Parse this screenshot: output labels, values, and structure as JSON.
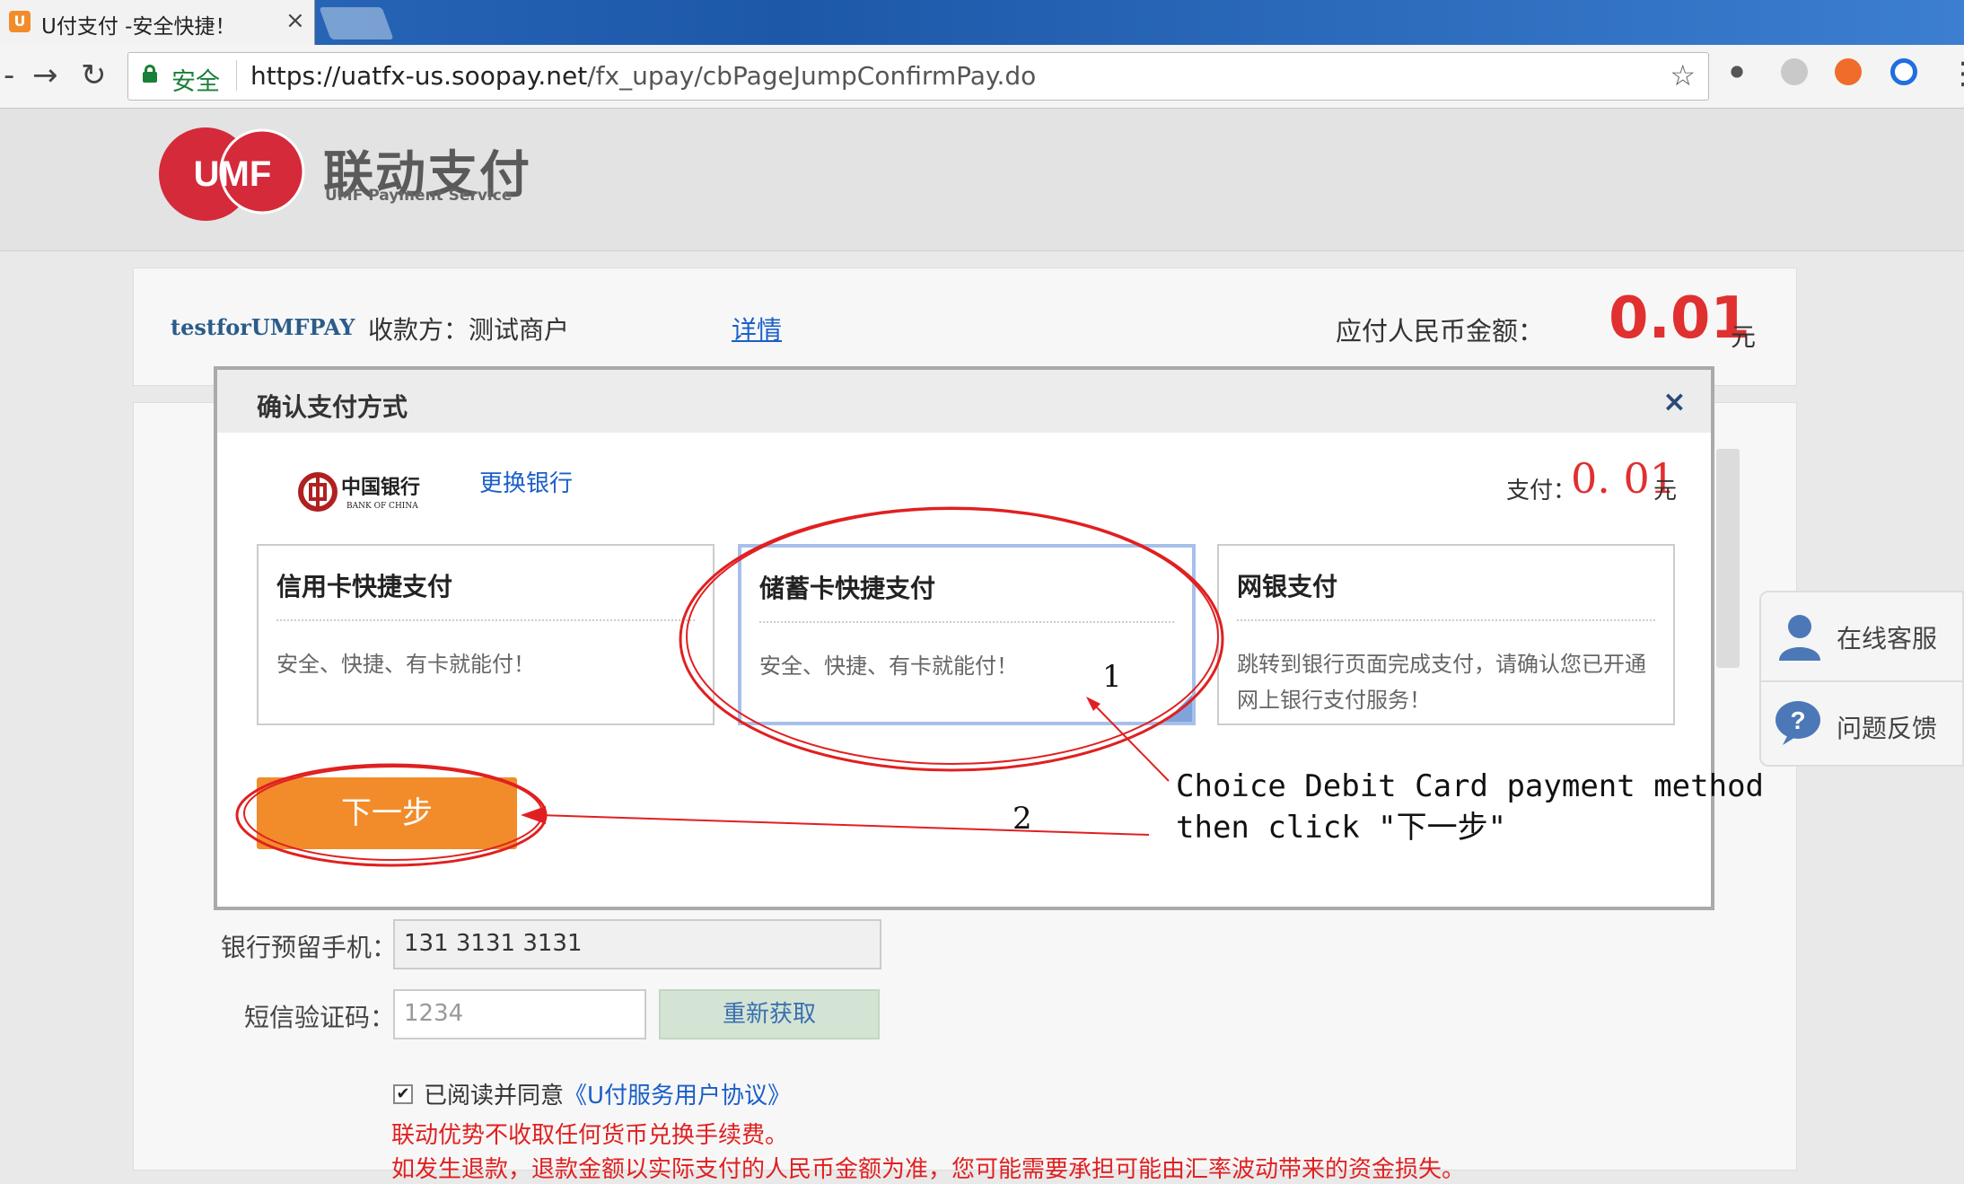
{
  "browser": {
    "tab_title": "U付支付 -安全快捷！",
    "tab_close": "×",
    "secure_label": "安全",
    "url_scheme": "https://",
    "url_host": "uatfx-us.soopay.net",
    "url_path": "/fx_upay/cbPageJumpConfirmPay.do"
  },
  "header": {
    "logo_mark": "UMF",
    "logo_cn": "联动支付",
    "logo_en": "UMF Payment Service"
  },
  "info": {
    "merchant_id": "testforUMFPAY",
    "payee": "收款方：测试商户",
    "detail_link": "详情",
    "amount_label": "应付人民币金额：",
    "amount": "0.01",
    "amount_unit": "元"
  },
  "modal": {
    "title": "确认支付方式",
    "close": "×",
    "bank_name_cn": "中国银行",
    "bank_name_en": "BANK OF CHINA",
    "change_bank": "更换银行",
    "pay_label": "支付：",
    "pay_amount": "0. 01",
    "pay_unit": "元",
    "options": [
      {
        "title": "信用卡快捷支付",
        "desc": "安全、快捷、有卡就能付！"
      },
      {
        "title": "储蓄卡快捷支付",
        "desc": "安全、快捷、有卡就能付！"
      },
      {
        "title": "网银支付",
        "desc": "跳转到银行页面完成支付，请确认您已开通网上银行支付服务！"
      }
    ],
    "next_button": "下一步"
  },
  "form": {
    "phone_label": "银行预留手机：",
    "phone_value": "131 3131 3131",
    "sms_label": "短信验证码：",
    "sms_value": "1234",
    "resend_button": "重新获取",
    "agree_check": "✔",
    "agree_text": "已阅读并同意",
    "agree_link": "《U付服务用户协议》",
    "notice1": "联动优势不收取任何货币兑换手续费。",
    "notice2": "如发生退款，退款金额以实际支付的人民币金额为准，您可能需要承担可能由汇率波动带来的资金损失。"
  },
  "side": {
    "online_service": "在线客服",
    "feedback": "问题反馈"
  },
  "annotations": {
    "num1": "1",
    "num2": "2",
    "line1": "Choice Debit Card payment method",
    "line2": "then click \"下一步\""
  },
  "colors": {
    "brand_red": "#d42a3a",
    "amount_red": "#e03030",
    "next_orange": "#f28c2a",
    "link_blue": "#1a5fc8"
  }
}
